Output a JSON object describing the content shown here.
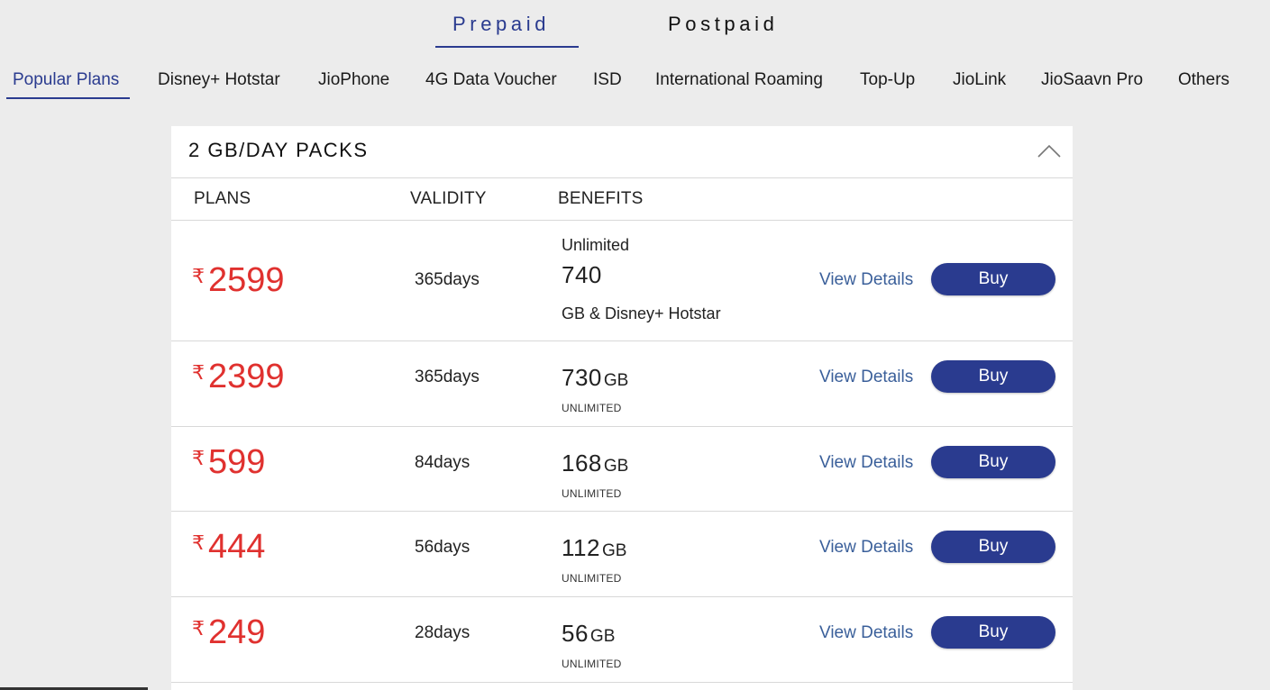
{
  "main_tabs": [
    {
      "label": "Prepaid",
      "active": true
    },
    {
      "label": "Postpaid",
      "active": false
    }
  ],
  "categories": [
    {
      "label": "Popular Plans",
      "active": true
    },
    {
      "label": "Disney+ Hotstar"
    },
    {
      "label": "JioPhone"
    },
    {
      "label": "4G Data Voucher"
    },
    {
      "label": "ISD"
    },
    {
      "label": "International Roaming"
    },
    {
      "label": "Top-Up"
    },
    {
      "label": "JioLink"
    },
    {
      "label": "JioSaavn Pro"
    },
    {
      "label": "Others"
    }
  ],
  "card": {
    "title": "2 GB/DAY PACKS",
    "collapse_icon": "chevron-up-icon",
    "columns": {
      "plans": "PLANS",
      "validity": "VALIDITY",
      "benefits": "BENEFITS"
    }
  },
  "plans": [
    {
      "currency": "₹",
      "price": "2599",
      "validity_num": "365",
      "validity_unit": "days",
      "benefit_top": "Unlimited",
      "benefit_value": "740",
      "benefit_bottom": "GB & Disney+ Hotstar",
      "view_label": "View Details",
      "buy_label": "Buy"
    },
    {
      "currency": "₹",
      "price": "2399",
      "validity_num": "365",
      "validity_unit": "days",
      "benefit_value": "730",
      "benefit_unit": "GB",
      "benefit_sub": "UNLIMITED",
      "view_label": "View Details",
      "buy_label": "Buy"
    },
    {
      "currency": "₹",
      "price": "599",
      "validity_num": "84",
      "validity_unit": "days",
      "benefit_value": "168",
      "benefit_unit": "GB",
      "benefit_sub": "UNLIMITED",
      "view_label": "View Details",
      "buy_label": "Buy"
    },
    {
      "currency": "₹",
      "price": "444",
      "validity_num": "56",
      "validity_unit": "days",
      "benefit_value": "112",
      "benefit_unit": "GB",
      "benefit_sub": "UNLIMITED",
      "view_label": "View Details",
      "buy_label": "Buy"
    },
    {
      "currency": "₹",
      "price": "249",
      "validity_num": "28",
      "validity_unit": "days",
      "benefit_value": "56",
      "benefit_unit": "GB",
      "benefit_sub": "UNLIMITED",
      "view_label": "View Details",
      "buy_label": "Buy"
    }
  ],
  "colors": {
    "accent": "#2a3b8f",
    "price": "#e0312f",
    "link": "#3a5f9a",
    "background": "#ececec"
  }
}
